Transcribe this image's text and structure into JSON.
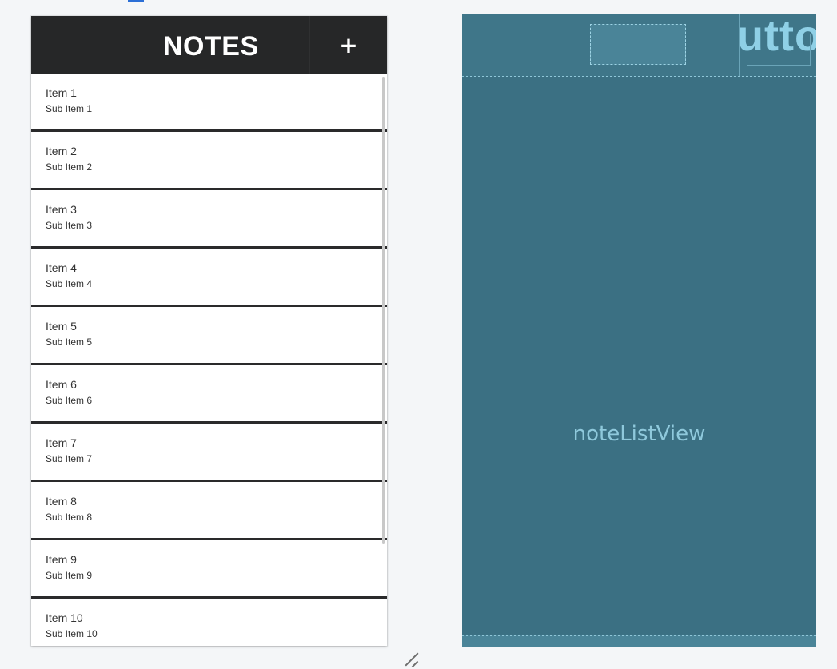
{
  "design_preview": {
    "header": {
      "title": "NOTES",
      "add_button_label": "+"
    },
    "list_items": [
      {
        "title": "Item 1",
        "subtitle": "Sub Item 1"
      },
      {
        "title": "Item 2",
        "subtitle": "Sub Item 2"
      },
      {
        "title": "Item 3",
        "subtitle": "Sub Item 3"
      },
      {
        "title": "Item 4",
        "subtitle": "Sub Item 4"
      },
      {
        "title": "Item 5",
        "subtitle": "Sub Item 5"
      },
      {
        "title": "Item 6",
        "subtitle": "Sub Item 6"
      },
      {
        "title": "Item 7",
        "subtitle": "Sub Item 7"
      },
      {
        "title": "Item 8",
        "subtitle": "Sub Item 8"
      },
      {
        "title": "Item 9",
        "subtitle": "Sub Item 9"
      },
      {
        "title": "Item 10",
        "subtitle": "Sub Item 10"
      }
    ]
  },
  "blueprint_preview": {
    "button_text_fragment": "utto",
    "list_view_id": "noteListView"
  },
  "colors": {
    "header_bg": "#262728",
    "blueprint_bg": "#3a7186",
    "blueprint_text": "#8fc9dc",
    "divider": "#2a2a2b",
    "accent": "#2b6fd6"
  }
}
